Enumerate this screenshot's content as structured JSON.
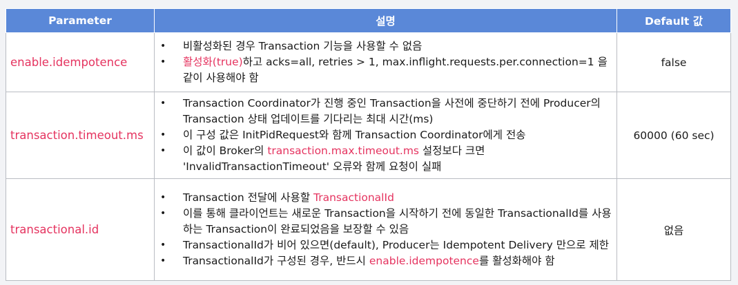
{
  "table": {
    "headers": [
      "Parameter",
      "설명",
      "Default 값"
    ],
    "rows": [
      {
        "param": "enable.idempotence",
        "default": "false",
        "bullets": [
          [
            {
              "t": "비활성화된 경우 Transaction 기능을 사용할 수 없음"
            }
          ],
          [
            {
              "t": "활성화(true)",
              "hl": true
            },
            {
              "t": "하고 acks=all, retries > 1, max.inflight.requests.per.connection=1 을 같이 사용해야 함"
            }
          ]
        ]
      },
      {
        "param": "transaction.timeout.ms",
        "default": "60000 (60 sec)",
        "bullets": [
          [
            {
              "t": "Transaction Coordinator가 진행 중인 Transaction을 사전에 중단하기 전에 Producer의 Transaction 상태 업데이트를 기다리는 최대 시간(ms)"
            }
          ],
          [
            {
              "t": "이 구성 값은 InitPidRequest와 함께 Transaction Coordinator에게 전송"
            }
          ],
          [
            {
              "t": "이 값이 Broker의 "
            },
            {
              "t": "transaction.max.timeout.ms",
              "hl": true
            },
            {
              "t": " 설정보다 크면 'InvalidTransactionTimeout' 오류와 함께 요청이 실패"
            }
          ]
        ]
      },
      {
        "param": "transactional.id",
        "default": "없음",
        "bullets": [
          [
            {
              "t": "Transaction 전달에 사용할 "
            },
            {
              "t": "TransactionalId",
              "hl": true
            }
          ],
          [
            {
              "t": "이를 통해 클라이언트는 새로운 Transaction을 시작하기 전에 동일한 TransactionalId를 사용하는 Transaction이 완료되었음을 보장할 수 있음"
            }
          ],
          [
            {
              "t": "TransactionalId가 비어 있으면(default), Producer는 Idempotent Delivery 만으로 제한"
            }
          ],
          [
            {
              "t": "TransactionalId가 구성된 경우, 반드시 "
            },
            {
              "t": "enable.idempotence",
              "hl": true
            },
            {
              "t": "를 활성화해야 함"
            }
          ]
        ]
      }
    ]
  },
  "colors": {
    "header_bg": "#5a88d8",
    "highlight": "#e5335f",
    "border": "#b9bcc2"
  }
}
